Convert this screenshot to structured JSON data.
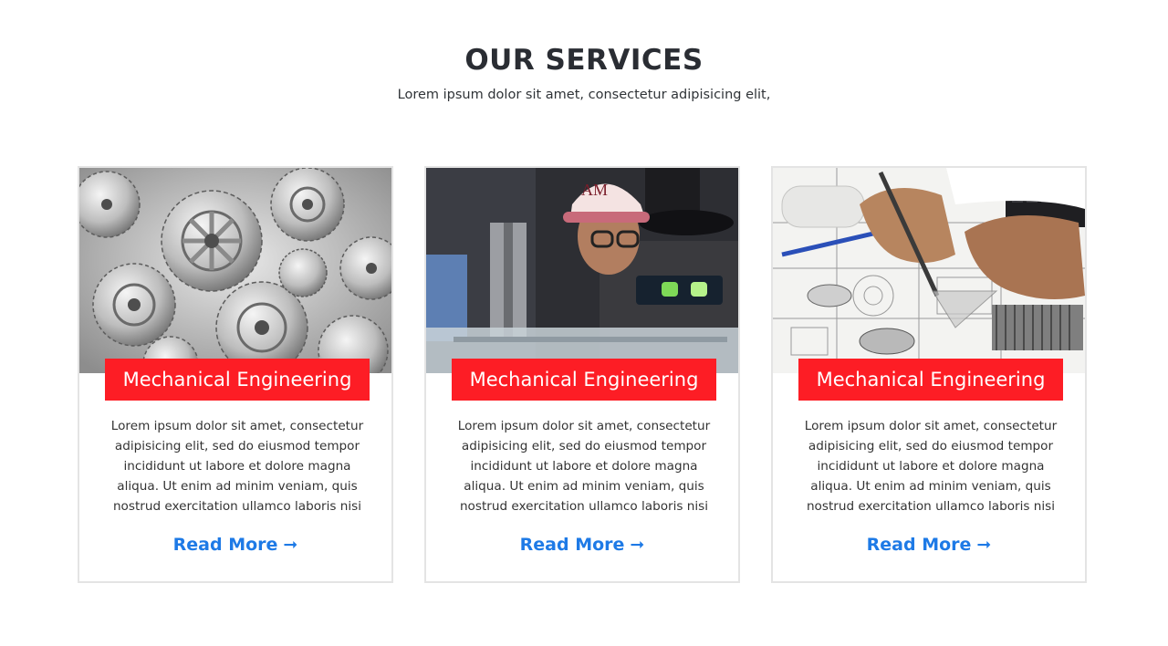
{
  "section": {
    "title": "OUR SERVICES",
    "subtitle": "Lorem ipsum dolor sit amet, consectetur adipisicing elit,"
  },
  "cards": [
    {
      "image": "gears-photo",
      "title": "Mechanical Engineering",
      "text": "Lorem ipsum dolor sit amet, consectetur adipisicing elit, sed do eiusmod tempor incididunt ut labore et dolore magna aliqua. Ut enim ad minim veniam, quis nostrud exercitation ullamco laboris nisi",
      "link_label": "Read More",
      "link_icon": "arrow-right-icon"
    },
    {
      "image": "engineer-with-level-photo",
      "title": "Mechanical Engineering",
      "text": "Lorem ipsum dolor sit amet, consectetur adipisicing elit, sed do eiusmod tempor incididunt ut labore et dolore magna aliqua. Ut enim ad minim veniam, quis nostrud exercitation ullamco laboris nisi",
      "link_label": "Read More",
      "link_icon": "arrow-right-icon"
    },
    {
      "image": "technical-drawing-photo",
      "title": "Mechanical Engineering",
      "text": "Lorem ipsum dolor sit amet, consectetur adipisicing elit, sed do eiusmod tempor incididunt ut labore et dolore magna aliqua. Ut enim ad minim veniam, quis nostrud exercitation ullamco laboris nisi",
      "link_label": "Read More",
      "link_icon": "arrow-right-icon"
    }
  ],
  "colors": {
    "title_band": "#fd1d25",
    "link": "#1e7ae6",
    "heading": "#2a2d33",
    "card_border": "#e4e4e4"
  }
}
